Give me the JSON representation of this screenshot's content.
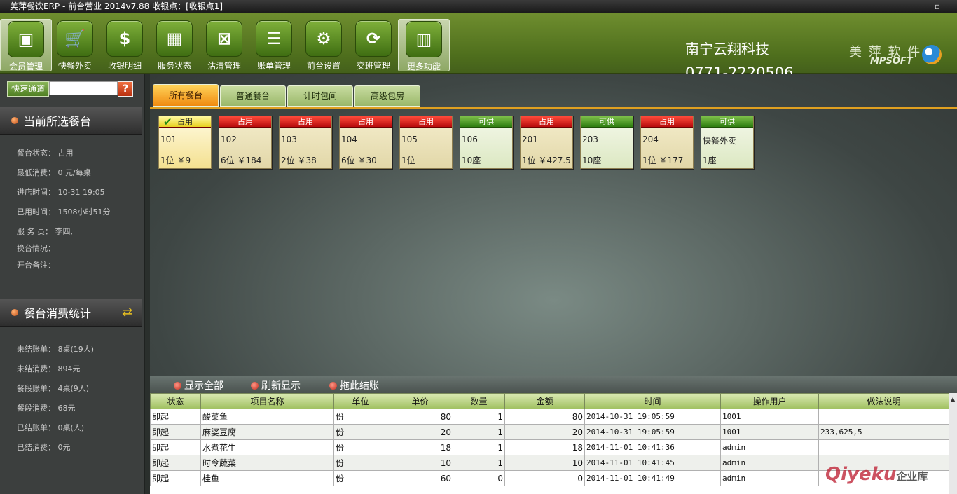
{
  "window": {
    "title": "美萍餐饮ERP - 前台营业 2014v7.88     收银点：[收银点1]",
    "min": "_",
    "restore": "▫"
  },
  "toolbar": {
    "buttons": [
      {
        "label": "会员管理",
        "glyph": "▣"
      },
      {
        "label": "快餐外卖",
        "glyph": "🛒"
      },
      {
        "label": "收银明细",
        "glyph": "$"
      },
      {
        "label": "服务状态",
        "glyph": "▦"
      },
      {
        "label": "沽清管理",
        "glyph": "⊠"
      },
      {
        "label": "账单管理",
        "glyph": "☰"
      },
      {
        "label": "前台设置",
        "glyph": "⚙"
      },
      {
        "label": "交班管理",
        "glyph": "⟳"
      },
      {
        "label": "更多功能",
        "glyph": "▥"
      }
    ],
    "company": "南宁云翔科技",
    "phone": "0771-2220506",
    "brand_cn": "美 萍 软 件",
    "brand_en": "MPSOFT"
  },
  "sidebar": {
    "quick_label": "快速通道",
    "quick_value": "",
    "help": "?",
    "current_title": "当前所选餐台",
    "current_info": [
      "餐台状态：  占用",
      "最低消费：  0 元/每桌",
      "进店时间：  10-31 19:05",
      "已用时间：  1508小时51分",
      "服 务 员：  李四,",
      "换台情况：",
      "开台备注："
    ],
    "stats_title": "餐台消费统计",
    "stats_info": [
      "未结账单：  8桌(19人)",
      "未结消费：  894元",
      "餐段账单：  4桌(9人)",
      "餐段消费：  68元",
      "已结账单：  0桌(人)",
      "已结消费：  0元"
    ]
  },
  "tabs": [
    "所有餐台",
    "普通餐台",
    "计时包间",
    "高级包房"
  ],
  "tables": [
    {
      "status": "占用",
      "name": "101",
      "detail": "1位 ￥9"
    },
    {
      "status": "占用",
      "name": "102",
      "detail": "6位 ￥184"
    },
    {
      "status": "占用",
      "name": "103",
      "detail": "2位 ￥38"
    },
    {
      "status": "占用",
      "name": "104",
      "detail": "6位 ￥30"
    },
    {
      "status": "占用",
      "name": "105",
      "detail": "1位"
    },
    {
      "status": "可供",
      "name": "106",
      "detail": "10座"
    },
    {
      "status": "占用",
      "name": "201",
      "detail": "1位 ￥427.5"
    },
    {
      "status": "可供",
      "name": "203",
      "detail": "10座"
    },
    {
      "status": "占用",
      "name": "204",
      "detail": "1位 ￥177"
    },
    {
      "status": "可供",
      "name": "快餐外卖",
      "detail": "1座"
    }
  ],
  "actions": [
    "显示全部",
    "刷新显示",
    "拖此结账"
  ],
  "grid": {
    "headers": [
      "状态",
      "项目名称",
      "单位",
      "单价",
      "数量",
      "金额",
      "时间",
      "操作用户",
      "做法说明"
    ],
    "rows": [
      [
        "即起",
        "酸菜鱼",
        "份",
        "80",
        "1",
        "80",
        "2014-10-31 19:05:59",
        "1001",
        ""
      ],
      [
        "即起",
        "麻婆豆腐",
        "份",
        "20",
        "1",
        "20",
        "2014-10-31 19:05:59",
        "1001",
        "233,625,5"
      ],
      [
        "即起",
        "水煮花生",
        "份",
        "18",
        "1",
        "18",
        "2014-11-01 10:41:36",
        "admin",
        ""
      ],
      [
        "即起",
        "时令蔬菜",
        "份",
        "10",
        "1",
        "10",
        "2014-11-01 10:41:45",
        "admin",
        ""
      ],
      [
        "即起",
        "桂鱼",
        "份",
        "60",
        "0",
        "0",
        "2014-11-01 10:41:49",
        "admin",
        ""
      ]
    ]
  },
  "watermark": {
    "main": "Qiyeku",
    "sub": "企业库"
  }
}
